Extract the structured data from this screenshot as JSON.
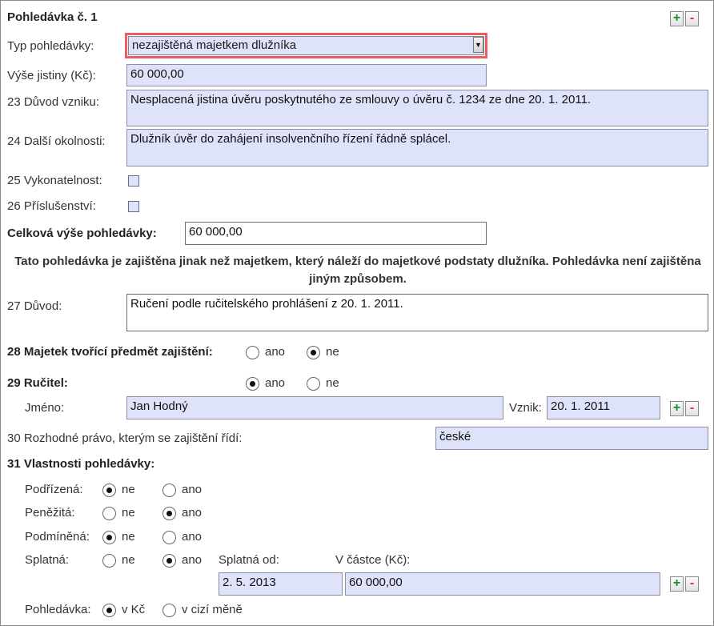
{
  "header": {
    "title": "Pohledávka č. 1",
    "add_label": "+",
    "remove_label": "-"
  },
  "typ": {
    "label": "Typ pohledávky:",
    "value": "nezajištěná majetkem dlužníka",
    "arrow": "▼"
  },
  "jistina": {
    "label": "Výše jistiny (Kč):",
    "value": "60 000,00"
  },
  "duvod_vzniku": {
    "label": "23 Důvod vzniku:",
    "value": "Nesplacená jistina úvěru poskytnutého ze smlouvy o úvěru č. 1234 ze dne 20. 1. 2011."
  },
  "dalsi_okolnosti": {
    "label": "24 Další okolnosti:",
    "value": "Dlužník úvěr do zahájení insolvenčního řízení řádně splácel."
  },
  "vykonatelnost": {
    "label": "25 Vykonatelnost:",
    "checked": false
  },
  "prislusenstvi": {
    "label": "26 Příslušenství:",
    "checked": false
  },
  "celkova": {
    "label": "Celková výše pohledávky:",
    "value": "60 000,00"
  },
  "note": "Tato pohledávka je zajištěna jinak než majetkem, který náleží do majetkové podstaty dlužníka. Pohledávka není zajištěna jiným způsobem.",
  "duvod": {
    "label": "27 Důvod:",
    "value": "Ručení podle ručitelského prohlášení z 20. 1. 2011."
  },
  "majetek": {
    "label": "28 Majetek tvořící předmět zajištění:",
    "ano": "ano",
    "ne": "ne",
    "selected": "ne"
  },
  "rucitel": {
    "label": "29 Ručitel:",
    "ano": "ano",
    "ne": "ne",
    "selected": "ano",
    "jmeno_label": "Jméno:",
    "jmeno": "Jan Hodný",
    "vznik_label": "Vznik:",
    "vznik": "20. 1. 2011",
    "add_label": "+",
    "remove_label": "-"
  },
  "pravo": {
    "label": "30 Rozhodné právo, kterým se zajištění řídí:",
    "value": "české"
  },
  "vlastnosti": {
    "label": "31 Vlastnosti pohledávky:",
    "podrizena": {
      "label": "Podřízená:",
      "opt1": "ne",
      "opt2": "ano",
      "selected": "ne"
    },
    "penezita": {
      "label": "Peněžitá:",
      "opt1": "ne",
      "opt2": "ano",
      "selected": "ano"
    },
    "podminena": {
      "label": "Podmíněná:",
      "opt1": "ne",
      "opt2": "ano",
      "selected": "ne"
    },
    "splatna": {
      "label": "Splatná:",
      "opt1": "ne",
      "opt2": "ano",
      "selected": "ano",
      "od_label": "Splatná od:",
      "castka_label": "V částce (Kč):",
      "od": "2. 5. 2013",
      "castka": "60 000,00",
      "add_label": "+",
      "remove_label": "-"
    },
    "pohledavka": {
      "label": "Pohledávka:",
      "opt1": "v Kč",
      "opt2": "v cizí měně",
      "selected": "v Kč"
    }
  }
}
